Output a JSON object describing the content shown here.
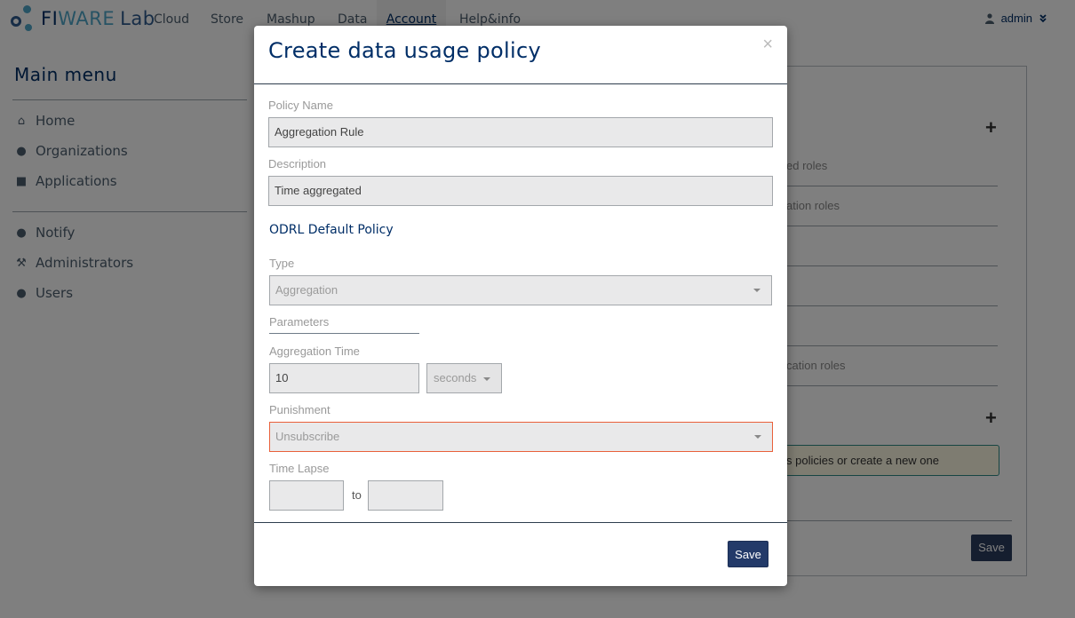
{
  "brand": {
    "name_part1": "FI",
    "name_part2": "WARE",
    "name_part3": "Lab"
  },
  "nav": {
    "items": [
      "Cloud",
      "Store",
      "Mashup",
      "Data",
      "Account",
      "Help&info"
    ],
    "active": "Account"
  },
  "user": {
    "name": "admin"
  },
  "sidebar": {
    "title": "Main menu",
    "group1": [
      "Home",
      "Organizations",
      "Applications"
    ],
    "group2": [
      "Notify",
      "Administrators",
      "Users"
    ]
  },
  "background": {
    "row1": "ed roles",
    "row2": "ation roles",
    "row6": "cation roles",
    "alert": "s policies or create a new one",
    "save_label": "Save",
    "plus": "+"
  },
  "modal": {
    "title": "Create data usage policy",
    "close": "×",
    "policy_name_label": "Policy Name",
    "policy_name_value": "Aggregation Rule",
    "description_label": "Description",
    "description_value": "Time aggregated",
    "section_title": "ODRL Default Policy",
    "type_label": "Type",
    "type_value": "Aggregation",
    "parameters_label": "Parameters",
    "aggregation_time_label": "Aggregation Time",
    "aggregation_time_value": "10",
    "aggregation_unit": "seconds",
    "punishment_label": "Punishment",
    "punishment_value": "Unsubscribe",
    "time_lapse_label": "Time Lapse",
    "time_lapse_from": "",
    "time_lapse_to": "",
    "to_label": "to",
    "save_label": "Save"
  },
  "colors": {
    "brand_navy": "#002e67",
    "accent_blue": "#4fa6c9",
    "save_button": "#233a69",
    "error_border": "#e9603a",
    "alert_bg": "#fcf8e3"
  }
}
